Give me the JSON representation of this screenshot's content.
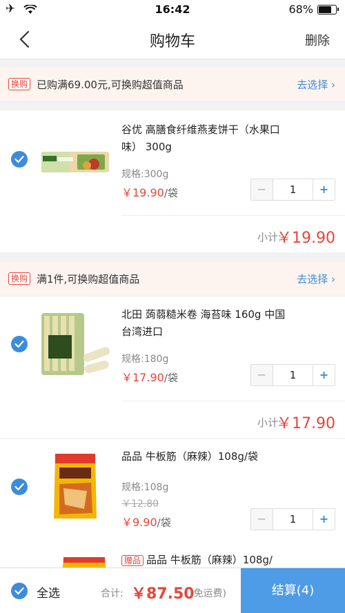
{
  "status_bar": {
    "time": "16:42",
    "battery": "68%"
  },
  "nav": {
    "title": "购物车",
    "delete_label": "删除"
  },
  "promo_1": {
    "tag": "换购",
    "text": "已购满69.00元,可换购超值商品",
    "choose": "去选择"
  },
  "promo_2": {
    "tag": "换购",
    "text": "满1件,可换购超值商品",
    "choose": "去选择"
  },
  "items": [
    {
      "name": "谷优 高膳食纤维燕麦饼干（水果口味） 300g",
      "spec": "规格:300g",
      "price": "￥19.90",
      "unit": "/袋",
      "qty": "1",
      "subtotal_label": "小计:",
      "subtotal": "￥19.90"
    },
    {
      "name": "北田 蒟蒻糙米卷 海苔味 160g 中国台湾进口",
      "spec": "规格:180g",
      "price": "￥17.90",
      "unit": "/袋",
      "qty": "1",
      "subtotal_label": "小计:",
      "subtotal": "￥17.90"
    },
    {
      "name": "品品 牛板筋（麻辣）108g/袋",
      "spec": "规格:108g",
      "orig_price": "￥12.80",
      "price": "￥9.90",
      "unit": "/袋",
      "qty": "1"
    },
    {
      "gift_tag": "赠品",
      "name": "品品 牛板筋（麻辣）108g/"
    }
  ],
  "stepper": {
    "minus": "−",
    "plus": "+"
  },
  "bottom": {
    "select_all": "全选",
    "total_label": "合计:",
    "total": "￥87.50",
    "freight": "(免运费)",
    "settle_label": "结算(4)"
  },
  "colors": {
    "accent": "#3d8cdb",
    "price": "#e8443a",
    "promo_bg": "#fdf4ef"
  }
}
